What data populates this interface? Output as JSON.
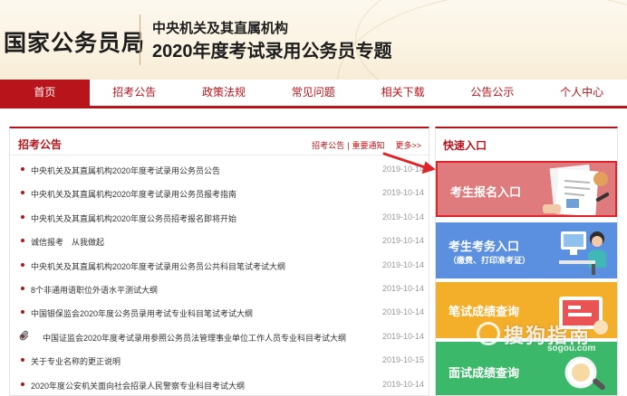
{
  "header": {
    "site_name": "国家公务员局",
    "subtitle_line1": "中央机关及其直属机构",
    "subtitle_line2": "2020年度考试录用公务员专题"
  },
  "nav": {
    "items": [
      {
        "label": "首页",
        "active": true
      },
      {
        "label": "招考公告"
      },
      {
        "label": "政策法规"
      },
      {
        "label": "常见问题"
      },
      {
        "label": "相关下载"
      },
      {
        "label": "公告公示"
      },
      {
        "label": "个人中心"
      }
    ]
  },
  "notice_panel": {
    "title": "招考公告",
    "link_notice": "招考公告",
    "separator": "|",
    "link_important": "重要通知",
    "more": "更多>>",
    "items": [
      {
        "title": "中央机关及其直属机构2020年度考试录用公务员公告",
        "date": "2019-10-14"
      },
      {
        "title": "中央机关及其直属机构2020年度考试录用公务员报考指南",
        "date": "2019-10-14"
      },
      {
        "title": "中央机关及其直属机构2020年度公务员招考报名即将开始",
        "date": "2019-10-14"
      },
      {
        "title": "诚信报考　从我做起",
        "date": "2019-10-14"
      },
      {
        "title": "中央机关及其直属机构2020年度考试录用公务员公共科目笔试考试大纲",
        "date": "2019-10-14"
      },
      {
        "title": "8个非通用语职位外语水平测试大纲",
        "date": "2019-10-14"
      },
      {
        "title": "中国银保监会2020年度公务员录用考试专业科目笔试考试大纲",
        "date": "2019-10-14"
      },
      {
        "title": "中国证监会2020年度考试录用参照公务员法管理事业单位工作人员专业科目考试大纲",
        "date": "2019-10-14",
        "icon": "paperclip-icon"
      },
      {
        "title": "关于专业名称的更正说明",
        "date": "2019-10-15"
      },
      {
        "title": "2020年度公安机关面向社会招录人民警察专业科目考试大纲",
        "date": "2019-10-14"
      }
    ]
  },
  "quick_entry": {
    "title": "快速入口",
    "items": [
      {
        "label": "考生报名入口"
      },
      {
        "label": "考生考务入口",
        "sub": "（缴费、打印准考证）"
      },
      {
        "label": "笔试成绩查询"
      },
      {
        "label": "面试成绩查询"
      }
    ]
  },
  "watermark": {
    "text": "搜狗指南",
    "url": "sogou.com"
  },
  "colors": {
    "brand_red": "#b8141b",
    "highlight_border": "#e02328",
    "entry_register": "#e07b7d",
    "entry_affairs": "#5b8fe0",
    "entry_written": "#f3ae2a",
    "entry_interview": "#3cb86a"
  }
}
